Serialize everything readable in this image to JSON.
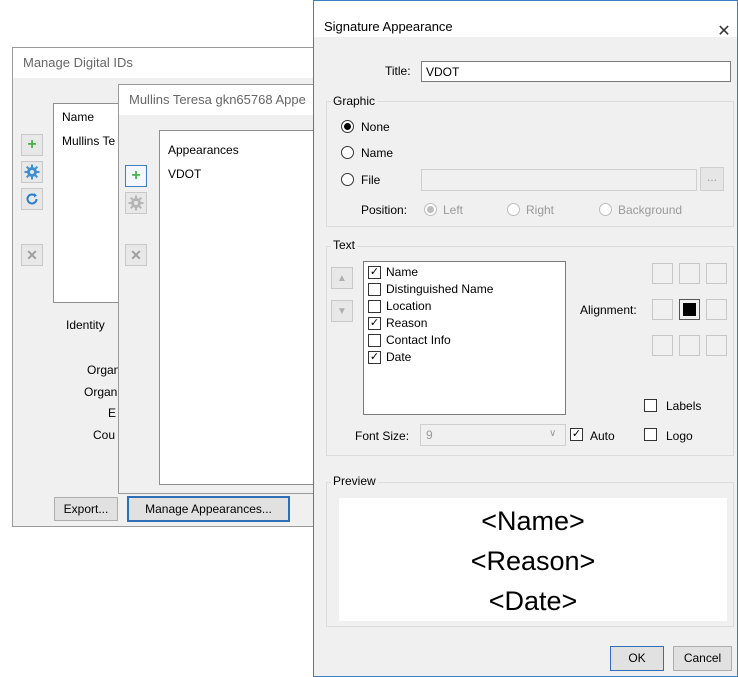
{
  "manage_ids": {
    "title": "Manage Digital IDs",
    "list_header": "Name",
    "list_item": "Mullins Te",
    "identity_label": "Identity",
    "field_labels": [
      "Organ",
      "Organ",
      "E",
      "Cou"
    ],
    "export_button": "Export...",
    "icons": [
      "plus-icon",
      "gear-icon",
      "refresh-icon",
      "delete-icon"
    ]
  },
  "appearances_dialog": {
    "title": "Mullins Teresa gkn65768 Appe",
    "list_header": "Appearances",
    "list_item": "VDOT",
    "manage_button": "Manage Appearances..."
  },
  "signature_dialog": {
    "title": "Signature Appearance",
    "title_label": "Title:",
    "title_value": "VDOT",
    "graphic": {
      "group_label": "Graphic",
      "options": [
        "None",
        "Name",
        "File"
      ],
      "selected": "None",
      "browse_label": "...",
      "position_label": "Position:",
      "positions": [
        "Left",
        "Right",
        "Background"
      ],
      "position_selected": "Left"
    },
    "text": {
      "group_label": "Text",
      "items": [
        {
          "label": "Name",
          "checked": true
        },
        {
          "label": "Distinguished Name",
          "checked": false
        },
        {
          "label": "Location",
          "checked": false
        },
        {
          "label": "Reason",
          "checked": true
        },
        {
          "label": "Contact Info",
          "checked": false
        },
        {
          "label": "Date",
          "checked": true
        }
      ],
      "alignment_label": "Alignment:",
      "alignment_selected": "center",
      "labels_label": "Labels",
      "labels_checked": false,
      "font_size_label": "Font Size:",
      "font_size_value": "9",
      "auto_label": "Auto",
      "auto_checked": true,
      "logo_label": "Logo",
      "logo_checked": false
    },
    "preview": {
      "group_label": "Preview",
      "lines": [
        "<Name>",
        "<Reason>",
        "<Date>"
      ]
    },
    "ok_button": "OK",
    "cancel_button": "Cancel",
    "close_glyph": "✕"
  }
}
